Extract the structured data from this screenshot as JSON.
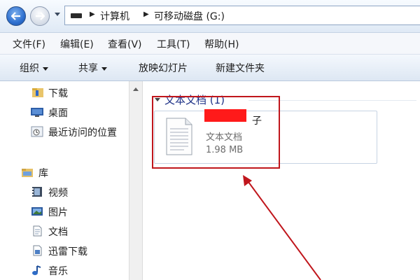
{
  "address": {
    "crumbs": [
      "计算机",
      "可移动磁盘 (G:)"
    ]
  },
  "menu": {
    "items": [
      "文件(F)",
      "编辑(E)",
      "查看(V)",
      "工具(T)",
      "帮助(H)"
    ]
  },
  "toolbar": {
    "organize": "组织",
    "share": "共享",
    "slideshow": "放映幻灯片",
    "new_folder": "新建文件夹"
  },
  "nav": {
    "downloads": "下载",
    "desktop": "桌面",
    "recent": "最近访问的位置",
    "libraries": "库",
    "videos": "视频",
    "pictures": "图片",
    "documents": "文档",
    "thunder": "迅雷下载",
    "music": "音乐"
  },
  "content": {
    "group_title": "文本文档 (1)",
    "file": {
      "name": "子",
      "type": "文本文档",
      "size": "1.98 MB"
    }
  },
  "colors": {
    "annotation": "#c0161c",
    "redaction": "#ff1a1a",
    "group_title": "#1e3287"
  }
}
